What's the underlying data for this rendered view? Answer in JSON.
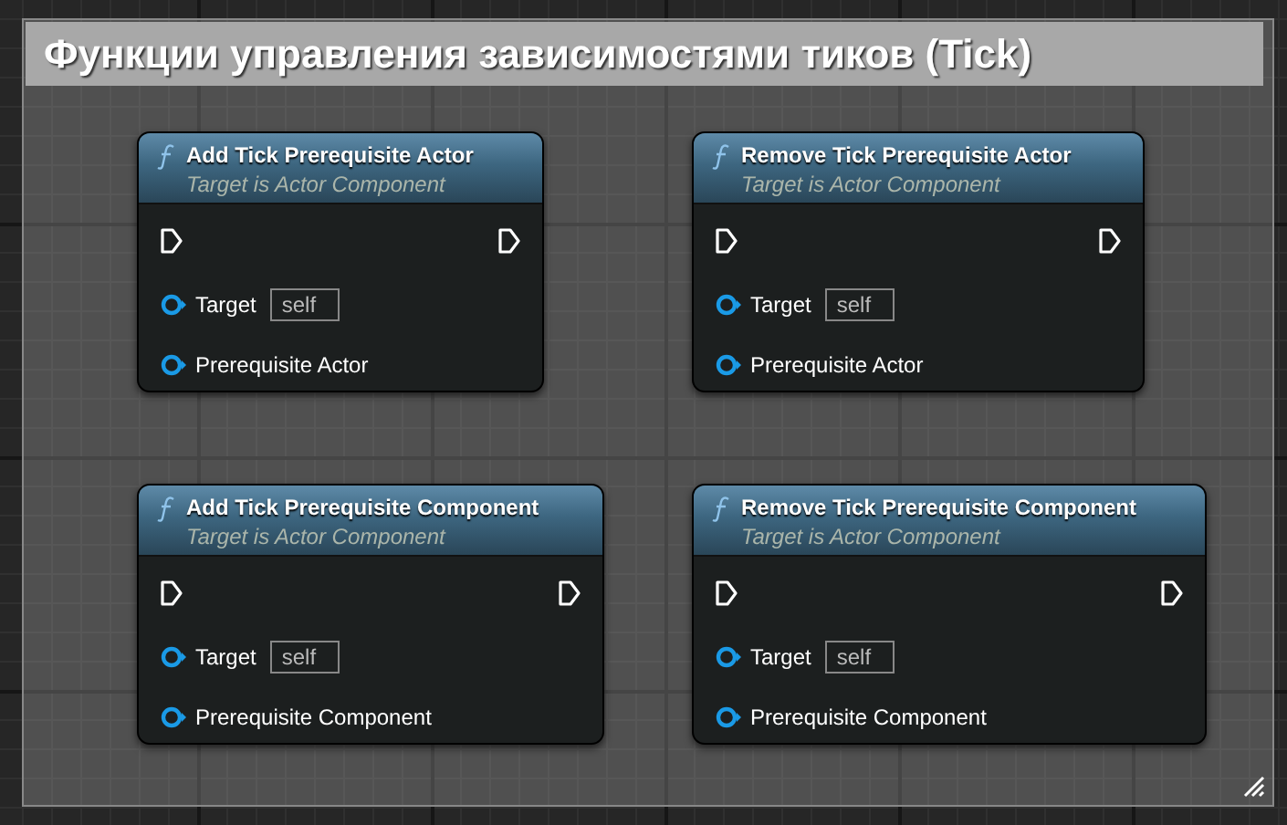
{
  "comment": {
    "title": "Функции управления зависимостями тиков (Tick)"
  },
  "nodes": [
    {
      "title": "Add Tick Prerequisite Actor",
      "subtitle": "Target is Actor Component",
      "inputs": [
        {
          "name": "Target",
          "default": "self"
        },
        {
          "name": "Prerequisite Actor"
        }
      ]
    },
    {
      "title": "Remove Tick Prerequisite Actor",
      "subtitle": "Target is Actor Component",
      "inputs": [
        {
          "name": "Target",
          "default": "self"
        },
        {
          "name": "Prerequisite Actor"
        }
      ]
    },
    {
      "title": "Add Tick Prerequisite Component",
      "subtitle": "Target is Actor Component",
      "inputs": [
        {
          "name": "Target",
          "default": "self"
        },
        {
          "name": "Prerequisite Component"
        }
      ]
    },
    {
      "title": "Remove Tick Prerequisite Component",
      "subtitle": "Target is Actor Component",
      "inputs": [
        {
          "name": "Target",
          "default": "self"
        },
        {
          "name": "Prerequisite Component"
        }
      ]
    }
  ]
}
